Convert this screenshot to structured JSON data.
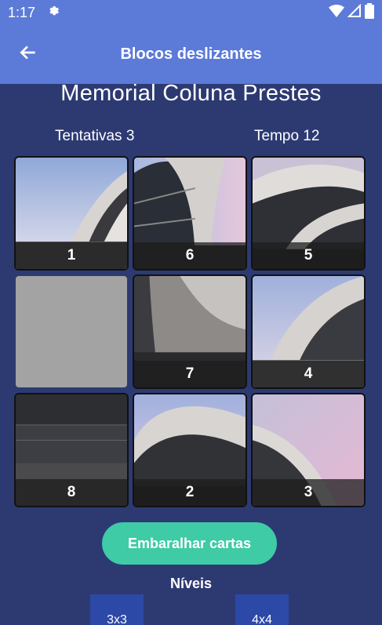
{
  "status_bar": {
    "time": "1:17"
  },
  "app_bar": {
    "title": "Blocos deslizantes"
  },
  "puzzle": {
    "title": "Memorial Coluna Prestes",
    "attempts_label": "Tentativas 3",
    "time_label": "Tempo 12",
    "tiles": [
      {
        "label": "1"
      },
      {
        "label": "6"
      },
      {
        "label": "5"
      },
      {
        "label": ""
      },
      {
        "label": "7"
      },
      {
        "label": "4"
      },
      {
        "label": "8"
      },
      {
        "label": "2"
      },
      {
        "label": "3"
      }
    ]
  },
  "shuffle_button": "Embaralhar cartas",
  "levels": {
    "title": "Níveis",
    "options": [
      "3x3",
      "4x4"
    ]
  },
  "colors": {
    "app_bar": "#5c7ad8",
    "background": "#2d3a72",
    "accent_button": "#3ecba6",
    "level_button": "#2c49a8",
    "empty_tile": "#a3a3a3"
  }
}
